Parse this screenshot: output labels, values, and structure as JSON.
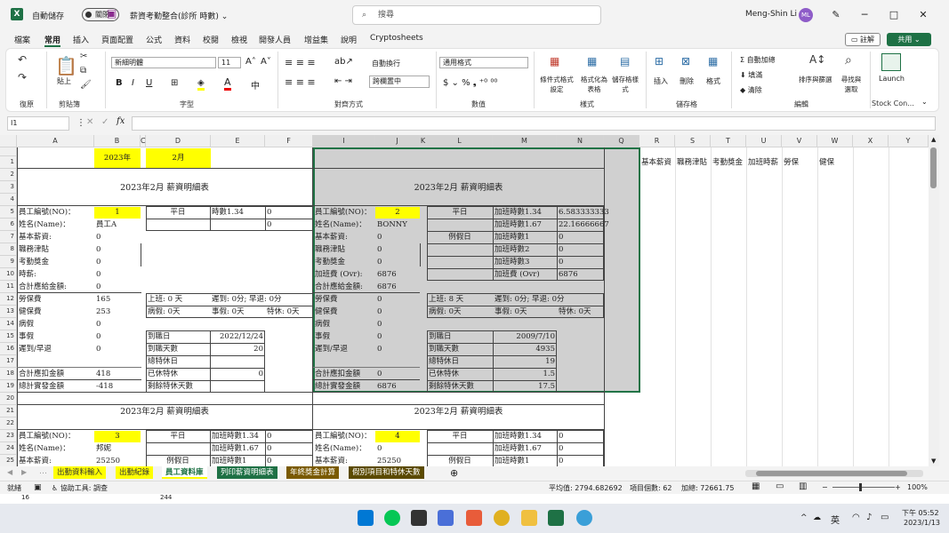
{
  "titlebar": {
    "autosave": "自動儲存",
    "toggle": "關閉",
    "filename": "薪資考勤整合(診所 時數) ⌄",
    "search": "搜尋",
    "user": "Meng-Shin Li",
    "initials": "ML"
  },
  "menu": [
    "檔案",
    "常用",
    "插入",
    "頁面配置",
    "公式",
    "資料",
    "校閱",
    "檢視",
    "開發人員",
    "增益集",
    "說明",
    "Cryptosheets"
  ],
  "menu_active": "常用",
  "comment_btn": "註解",
  "share_btn": "共用 ⌄",
  "ribbon": {
    "undo": "復原",
    "clipboard": "剪貼簿",
    "paste": "貼上",
    "font_group": "字型",
    "font_name": "新細明體",
    "font_size": "11",
    "align_group": "對齊方式",
    "wrap": "自動換行",
    "merge": "跨欄置中",
    "number_group": "數值",
    "number_format": "通用格式",
    "styles_group": "樣式",
    "cond_format": "條件式格式設定",
    "table_format": "格式化為表格",
    "cell_style": "儲存格樣式",
    "cells_group": "儲存格",
    "insert": "插入",
    "delete": "刪除",
    "format": "格式",
    "edit_group": "編輯",
    "autosum": "自動加總",
    "fill": "填滿",
    "clear": "清除",
    "sort": "排序與篩選",
    "find": "尋找與選取",
    "launch": "Launch",
    "stock": "Stock Con..."
  },
  "namebox": "I1",
  "columns": [
    "A",
    "B",
    "C",
    "D",
    "E",
    "F",
    "I",
    "J",
    "K",
    "L",
    "M",
    "N",
    "Q",
    "R",
    "S",
    "T",
    "U",
    "V",
    "W",
    "X",
    "Y"
  ],
  "rows": [
    "1",
    "2",
    "3",
    "4",
    "5",
    "6",
    "7",
    "8",
    "9",
    "10",
    "11",
    "12",
    "13",
    "14",
    "15",
    "16",
    "17",
    "18",
    "19",
    "20",
    "21",
    "22",
    "23",
    "24",
    "25"
  ],
  "cells": {
    "b1": "2023年",
    "d1": "2月",
    "title1": "2023年2月 薪資明細表",
    "title2": "2023年2月 薪資明細表",
    "title3": "2023年2月 薪資明細表",
    "title4": "2023年2月 薪資明細表",
    "a5": "員工編號(NO)：",
    "b5": "1",
    "d5": "平日",
    "e5": "時數1.34",
    "f5": "0",
    "a6": "姓名(Name)：",
    "b6": "員工A",
    "f6": "0",
    "a7": "基本薪資:",
    "b7": "0",
    "a8": "職務津貼",
    "b8": "0",
    "a9": "考勤獎金",
    "b9": "0",
    "a10": "時薪:",
    "b10": "0",
    "a11": "合計應給金額:",
    "b11": "0",
    "a12": "勞保費",
    "b12": "165",
    "d12": "上班: 0 天",
    "e12": "遲到: 0分; 早退: 0分",
    "a13": "健保費",
    "b13": "253",
    "d13": "病假: 0天",
    "e13": "事假: 0天",
    "f13": "特休: 0天",
    "a14": "病假",
    "b14": "0",
    "a15": "事假",
    "b15": "0",
    "d15": "到職日",
    "e15": "2022/12/24",
    "a16": "遲到/早退",
    "b16": "0",
    "d16": "到職天數",
    "e16": "20",
    "d17": "總特休日",
    "a18": "合計應扣金額",
    "b18": "418",
    "d18": "已休特休",
    "e18": "0",
    "a19": "總計實發金額",
    "b19": "-418",
    "d19": "剩餘特休天數",
    "i5": "員工編號(NO)：",
    "j5": "2",
    "l5": "平日",
    "m5": "加班時數1.34",
    "n5": "6.583333333",
    "i6": "姓名(Name)：",
    "j6": "BONNY",
    "m6": "加班時數1.67",
    "n6": "22.16666667",
    "i7": "基本薪資:",
    "j7": "0",
    "l7": "例假日",
    "m7": "加班時數1",
    "n7": "0",
    "i8": "職務津貼",
    "j8": "0",
    "m8": "加班時數2",
    "n8": "0",
    "i9": "考勤獎金",
    "j9": "0",
    "m9": "加班時數3",
    "n9": "0",
    "i10": "加班費 (Ovr):",
    "j10": "6876",
    "m10": "加班費 (Ovr)",
    "n10": "6876",
    "i11": "合計應給金額:",
    "j11": "6876",
    "i12": "勞保費",
    "j12": "0",
    "l12": "上班: 8 天",
    "m12": "遲到: 0分; 早退: 0分",
    "i13": "健保費",
    "j13": "0",
    "l13": "病假: 0天",
    "m13": "事假: 0天",
    "n13": "特休: 0天",
    "i14": "病假",
    "j14": "0",
    "i15": "事假",
    "j15": "0",
    "l15": "到職日",
    "m15": "2009/7/10",
    "i16": "遲到/早退",
    "j16": "0",
    "l16": "到職天數",
    "m16": "4935",
    "l17": "總特休日",
    "m17": "19",
    "i18": "合計應扣金額",
    "j18": "0",
    "l18": "已休特休",
    "m18": "1.5",
    "i19": "總計實發金額",
    "j19": "6876",
    "l19": "剩餘特休天數",
    "m19": "17.5",
    "r1": "基本薪資",
    "s1": "職務津貼",
    "t1": "考勤獎金",
    "u1": "加班時薪",
    "v1": "勞保",
    "w1": "健保",
    "a23": "員工編號(NO)：",
    "b23": "3",
    "d23": "平日",
    "e23": "加班時數1.34",
    "f23": "0",
    "a24": "姓名(Name)：",
    "b24": "邦妮",
    "e24": "加班時數1.67",
    "f24": "0",
    "a25": "基本薪資:",
    "b25": "25250",
    "d25": "例假日",
    "e25": "加班時數1",
    "f25": "0",
    "i23": "員工編號(NO)：",
    "j23": "4",
    "l23": "平日",
    "m23": "加班時數1.34",
    "n23": "0",
    "i24": "姓名(Name)：",
    "j24": "0",
    "m24": "加班時數1.67",
    "n24": "0",
    "i25": "基本薪資:",
    "j25": "25250",
    "l25": "例假日",
    "m25": "加班時數1",
    "n25": "0"
  },
  "sheets": [
    "出勤資料輸入",
    "出勤紀錄",
    "員工資料庫",
    "列印薪資明細表",
    "年終獎金計算",
    "假別項目和特休天數"
  ],
  "active_sheet": "員工資料庫",
  "status": {
    "ready": "就緒",
    "accessibility": "協助工具: 調查",
    "average": "平均值: 2794.682692",
    "count": "項目個數: 62",
    "sum": "加總: 72661.75",
    "zoom": "100%",
    "row_hint": "16",
    "cell_hint": "244"
  },
  "taskbar": {
    "ime": "英",
    "time": "下午 05:52",
    "date": "2023/1/13"
  },
  "colors": {
    "accent": "#1e7145",
    "yellow": "#ffff00",
    "selection": "#217346"
  }
}
